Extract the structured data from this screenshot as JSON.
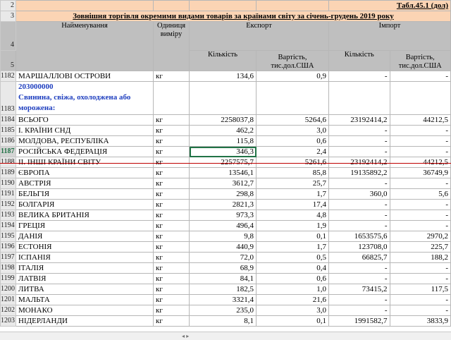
{
  "sheet": {
    "table_id": "Табл.45.1 (дол)",
    "title": "Зовнішня торгівля окремими видами товарів за країнами світу  за  січень-грудень 2019 року",
    "headers": {
      "name": "Найменування",
      "unit": "Одиниця виміру",
      "export": "Експорт",
      "import": "Імпорт",
      "qty": "Кількість",
      "value": "Вартість, тис.дол.США"
    },
    "header_row_numbers": [
      "2",
      "3",
      "4",
      "5"
    ],
    "rows": [
      {
        "rn": "1182",
        "name": "МАРШАЛЛОВІ ОСТРОВИ",
        "unit": "кг",
        "eq": "134,6",
        "ev": "0,9",
        "iq": "-",
        "iv": "-"
      },
      {
        "rn": "1183",
        "name_lines": [
          "203000000",
          "Свинина, свіжа, охолоджена або",
          "морожена:"
        ],
        "unit": "",
        "eq": "",
        "ev": "",
        "iq": "",
        "iv": ""
      },
      {
        "rn": "1184",
        "name": "  ВСЬОГО",
        "unit": "кг",
        "eq": "2258037,8",
        "ev": "5264,6",
        "iq": "23192414,2",
        "iv": "44212,5"
      },
      {
        "rn": "1185",
        "name": " І. КРАЇНИ СНД",
        "unit": "кг",
        "eq": "462,2",
        "ev": "3,0",
        "iq": "-",
        "iv": "-"
      },
      {
        "rn": "1186",
        "name": "МОЛДОВА, РЕСПУБЛІКА",
        "unit": "кг",
        "eq": "115,8",
        "ev": "0,6",
        "iq": "-",
        "iv": "-"
      },
      {
        "rn": "1187",
        "name": "РОСІЙСЬКА ФЕДЕРАЦІЯ",
        "unit": "кг",
        "eq": "346,3",
        "ev": "2,4",
        "iq": "-",
        "iv": "-"
      },
      {
        "rn": "1188",
        "name": " ІІ. ІНШІ КРАЇНИ СВІТУ",
        "unit": "кг",
        "eq": "2257575,7",
        "ev": "5261,6",
        "iq": "23192414,2",
        "iv": "44212,5"
      },
      {
        "rn": "1189",
        "name": "  ЄВРОПА",
        "unit": "кг",
        "eq": "13546,1",
        "ev": "85,8",
        "iq": "19135892,2",
        "iv": "36749,9"
      },
      {
        "rn": "1190",
        "name": "АВСТРІЯ",
        "unit": "кг",
        "eq": "3612,7",
        "ev": "25,7",
        "iq": "-",
        "iv": "-"
      },
      {
        "rn": "1191",
        "name": "БЕЛЬГІЯ",
        "unit": "кг",
        "eq": "298,8",
        "ev": "1,7",
        "iq": "360,0",
        "iv": "5,6"
      },
      {
        "rn": "1192",
        "name": "БОЛГАРІЯ",
        "unit": "кг",
        "eq": "2821,3",
        "ev": "17,4",
        "iq": "-",
        "iv": "-"
      },
      {
        "rn": "1193",
        "name": "ВЕЛИКА БРИТАНІЯ",
        "unit": "кг",
        "eq": "973,3",
        "ev": "4,8",
        "iq": "-",
        "iv": "-"
      },
      {
        "rn": "1194",
        "name": "ГРЕЦІЯ",
        "unit": "кг",
        "eq": "496,4",
        "ev": "1,9",
        "iq": "-",
        "iv": "-"
      },
      {
        "rn": "1195",
        "name": "ДАНІЯ",
        "unit": "кг",
        "eq": "9,8",
        "ev": "0,1",
        "iq": "1653575,6",
        "iv": "2970,2"
      },
      {
        "rn": "1196",
        "name": "ЕСТОНІЯ",
        "unit": "кг",
        "eq": "440,9",
        "ev": "1,7",
        "iq": "123708,0",
        "iv": "225,7"
      },
      {
        "rn": "1197",
        "name": "ІСПАНІЯ",
        "unit": "кг",
        "eq": "72,0",
        "ev": "0,5",
        "iq": "66825,7",
        "iv": "188,2"
      },
      {
        "rn": "1198",
        "name": "ІТАЛІЯ",
        "unit": "кг",
        "eq": "68,9",
        "ev": "0,4",
        "iq": "-",
        "iv": "-"
      },
      {
        "rn": "1199",
        "name": "ЛАТВІЯ",
        "unit": "кг",
        "eq": "84,1",
        "ev": "0,6",
        "iq": "-",
        "iv": "-"
      },
      {
        "rn": "1200",
        "name": "ЛИТВА",
        "unit": "кг",
        "eq": "182,5",
        "ev": "1,0",
        "iq": "73415,2",
        "iv": "117,5"
      },
      {
        "rn": "1201",
        "name": "МАЛЬТА",
        "unit": "кг",
        "eq": "3321,4",
        "ev": "21,6",
        "iq": "-",
        "iv": "-"
      },
      {
        "rn": "1202",
        "name": "МОНАКО",
        "unit": "кг",
        "eq": "235,0",
        "ev": "3,0",
        "iq": "-",
        "iv": "-"
      },
      {
        "rn": "1203",
        "name": "НІДЕРЛАНДИ",
        "unit": "кг",
        "eq": "8,1",
        "ev": "0,1",
        "iq": "1991582,7",
        "iv": "3833,9"
      }
    ],
    "selected_row": "1187"
  },
  "colors": {
    "header_bg": "#bfbfbf",
    "title_bg": "#fbd4b4",
    "highlight_text": "#1f3fbf",
    "selection": "#217346",
    "freeze_line": "#c00000"
  }
}
